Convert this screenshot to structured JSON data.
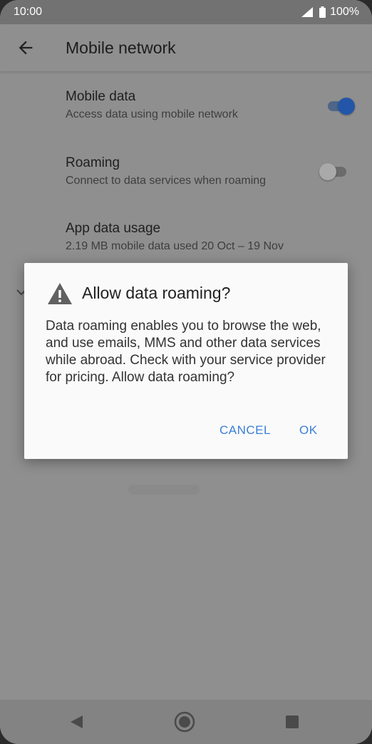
{
  "status_bar": {
    "time": "10:00",
    "battery": "100%"
  },
  "app_bar": {
    "title": "Mobile network"
  },
  "settings": [
    {
      "title": "Mobile data",
      "summary": "Access data using mobile network",
      "toggle": "on"
    },
    {
      "title": "Roaming",
      "summary": "Connect to data services when roaming",
      "toggle": "off"
    },
    {
      "title": "App data usage",
      "summary": "2.19 MB mobile data used 20 Oct – 19 Nov"
    }
  ],
  "dialog": {
    "title": "Allow data roaming?",
    "message": "Data roaming enables you to browse the web, and use emails, MMS and other data services while abroad. Check with your service provider for pricing. Allow data roaming?",
    "cancel_label": "CANCEL",
    "ok_label": "OK"
  },
  "colors": {
    "accent": "#3b7fd6",
    "toggle_on": "#2356a8"
  },
  "icons": {
    "back": "arrow-left-icon",
    "warning": "warning-triangle-icon",
    "signal": "signal-icon",
    "battery": "battery-icon",
    "nav_back": "nav-back-icon",
    "nav_home": "nav-home-icon",
    "nav_recents": "nav-recents-icon"
  }
}
